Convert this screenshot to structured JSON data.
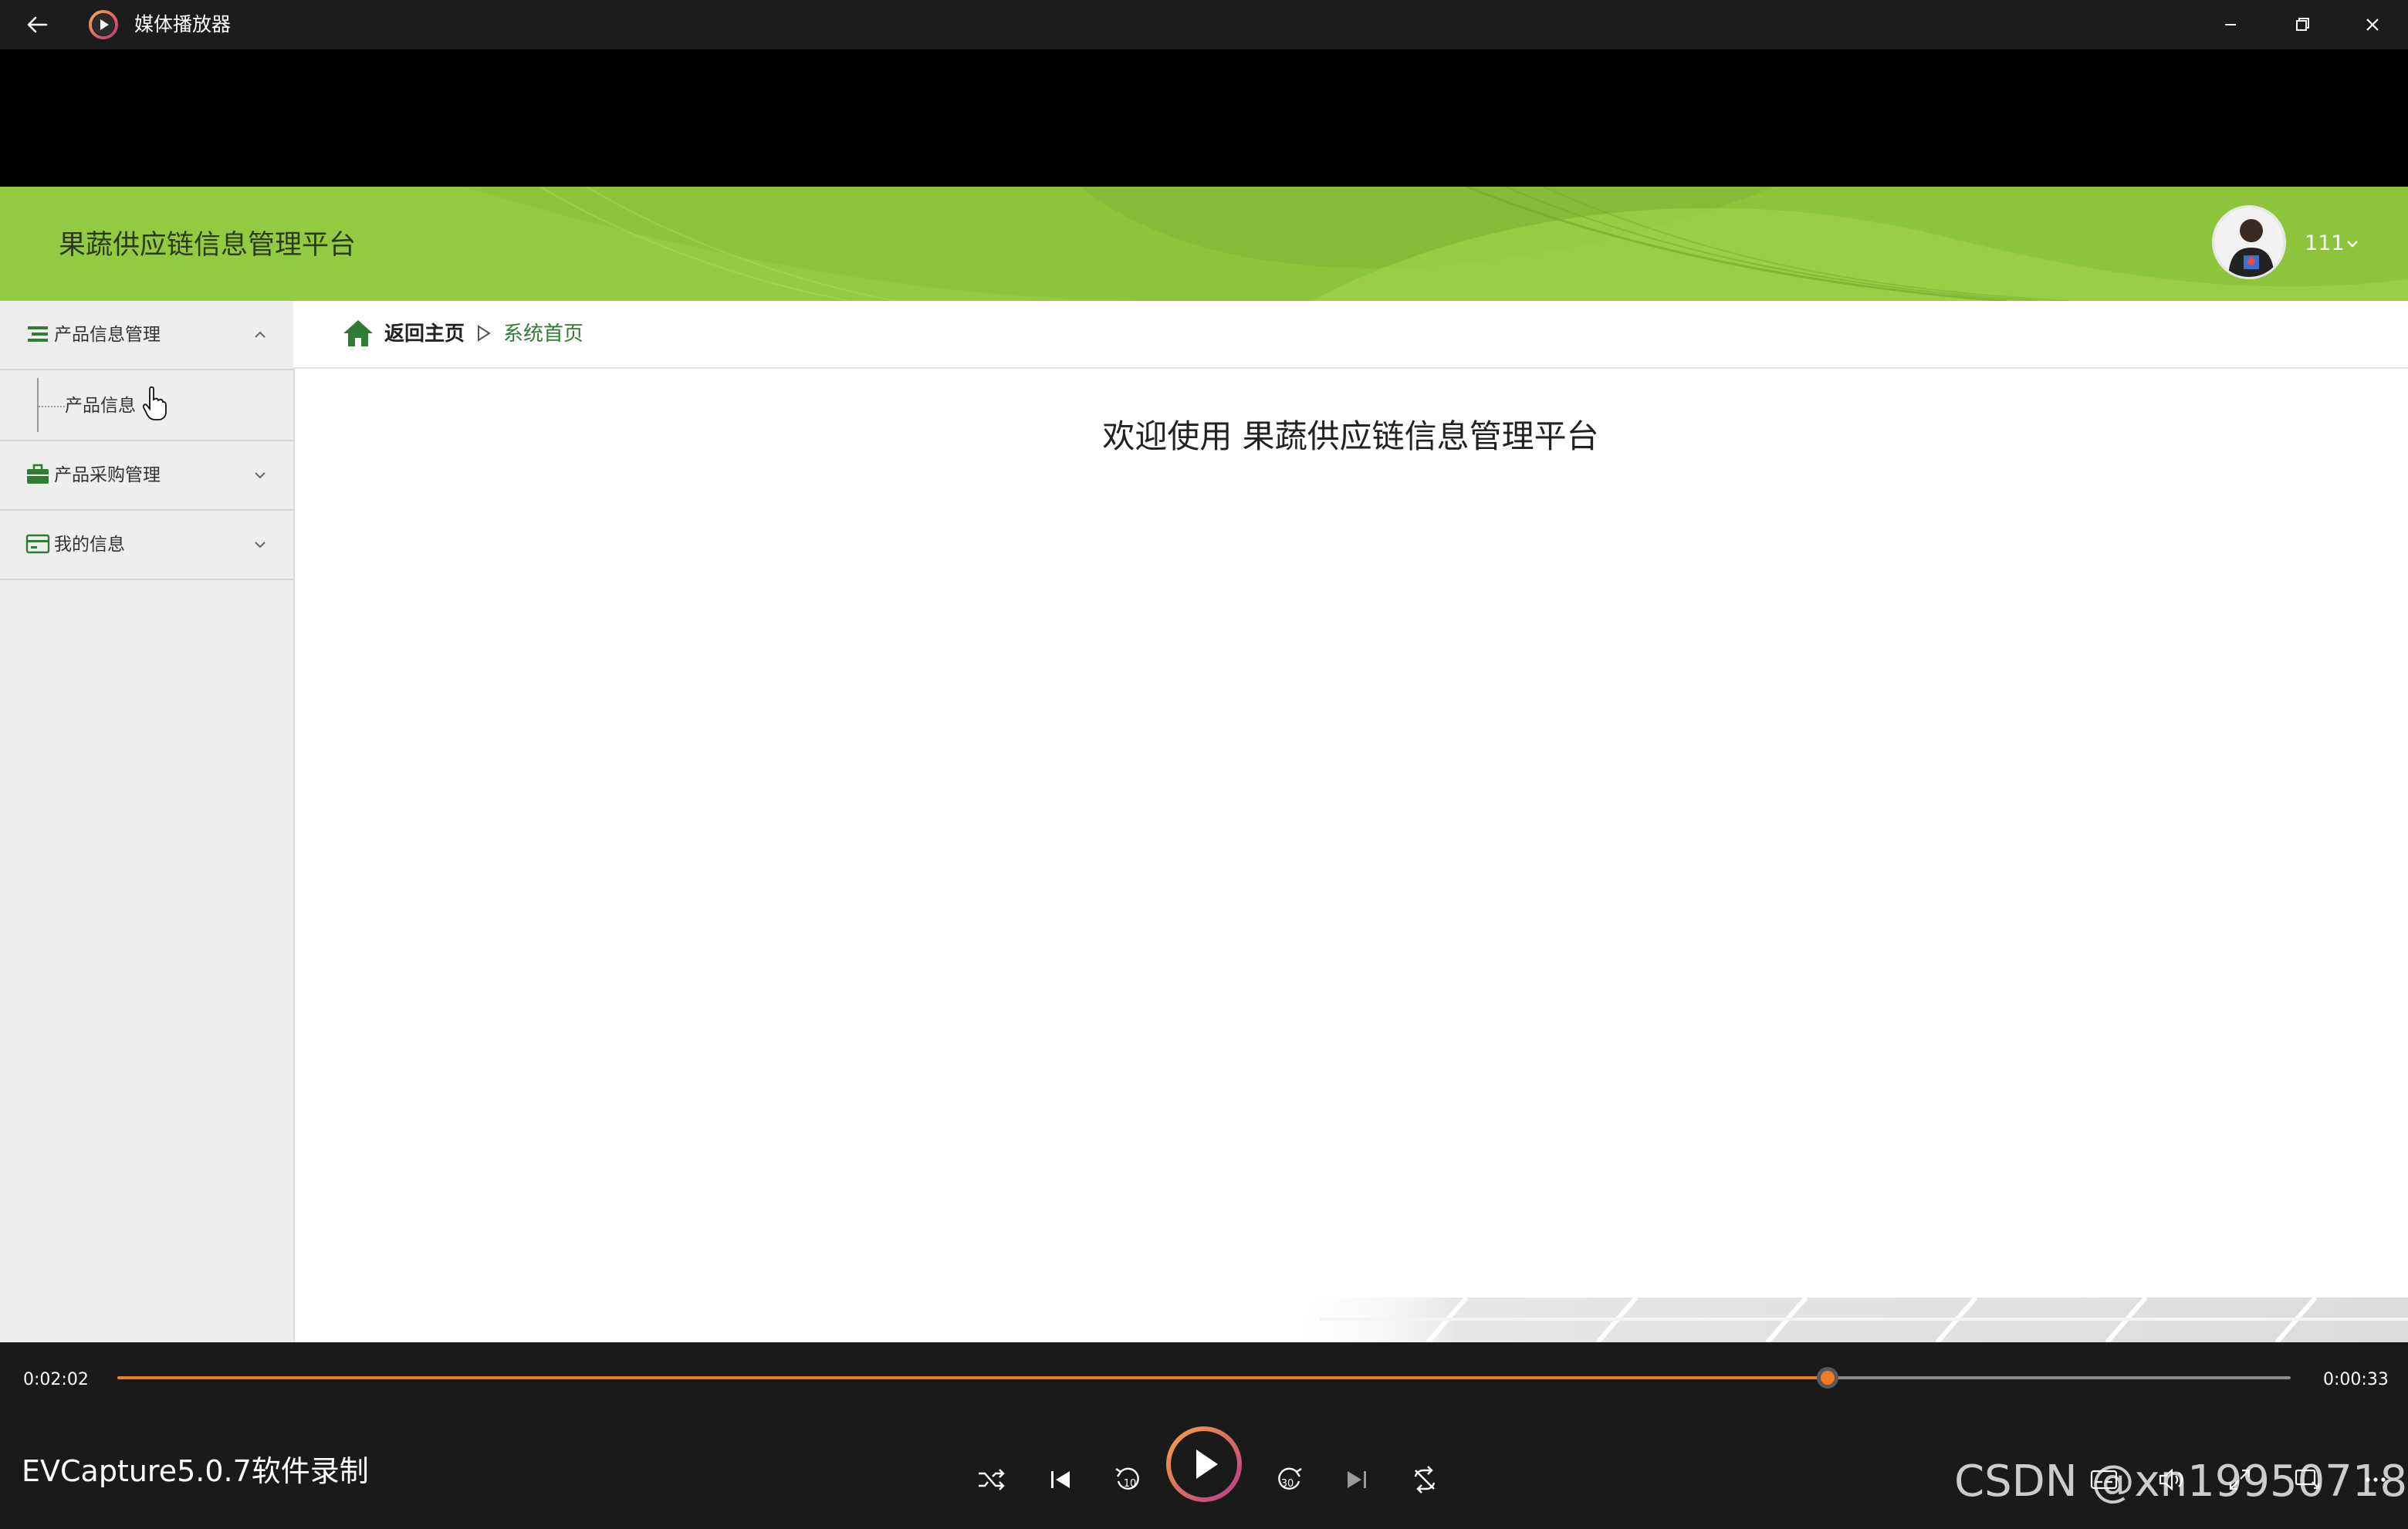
{
  "window": {
    "app_title": "媒体播放器"
  },
  "webapp": {
    "site_title": "果蔬供应链信息管理平台",
    "user_name": "111",
    "sidebar": {
      "groups": [
        {
          "label": "产品信息管理",
          "icon": "list-icon",
          "expanded": true,
          "items": [
            {
              "label": "产品信息"
            }
          ]
        },
        {
          "label": "产品采购管理",
          "icon": "briefcase-icon",
          "expanded": false
        },
        {
          "label": "我的信息",
          "icon": "card-icon",
          "expanded": false
        }
      ]
    },
    "breadcrumb": {
      "home_label": "返回主页",
      "current_label": "系统首页"
    },
    "welcome_text": "欢迎使用 果蔬供应链信息管理平台",
    "colors": {
      "header_green": "#8fc63e",
      "accent_green": "#2e7d32"
    }
  },
  "player": {
    "current_time": "0:02:02",
    "remaining_time": "0:00:33",
    "progress": 0.787,
    "media_title": "EVCapture5.0.7软件录制",
    "accent": "#f07a26",
    "buttons": [
      "shuffle-icon",
      "previous-icon",
      "rewind-10-icon",
      "play-icon",
      "forward-30-icon",
      "next-icon",
      "repeat-icon",
      "subtitles-icon",
      "volume-icon",
      "fullscreen-icon",
      "mini-view-icon",
      "more-icon"
    ]
  },
  "watermark": "CSDN @xn19950718"
}
